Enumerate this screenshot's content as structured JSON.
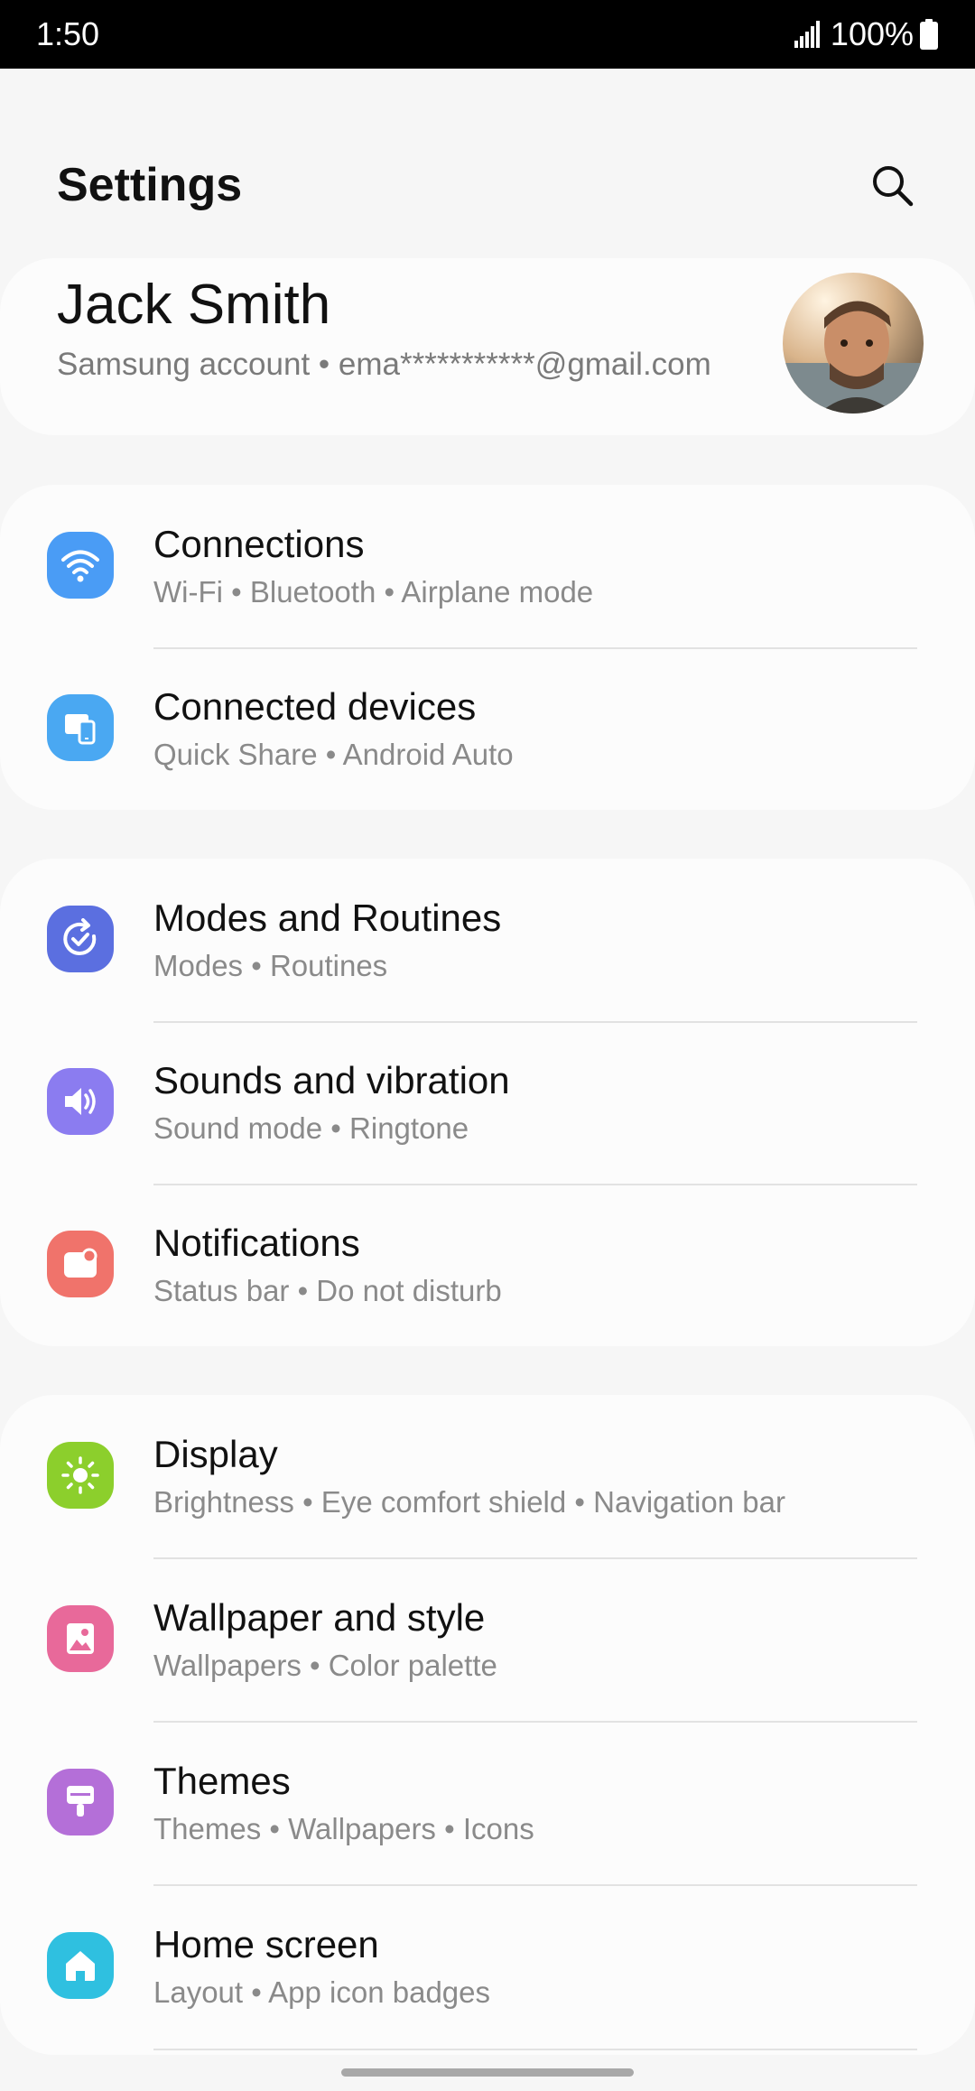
{
  "status": {
    "time": "1:50",
    "battery": "100%"
  },
  "header": {
    "title": "Settings"
  },
  "account": {
    "name": "Jack Smith",
    "subtitle": "Samsung account  •  ema***********@gmail.com"
  },
  "menu": [
    {
      "title": "Connections",
      "subtitle": "Wi-Fi  •  Bluetooth  •  Airplane mode",
      "icon": "wifi-icon",
      "color": "#4a9cf5"
    },
    {
      "title": "Connected devices",
      "subtitle": "Quick Share  •  Android Auto",
      "icon": "connected-devices-icon",
      "color": "#4aa8f2"
    },
    {
      "title": "Modes and Routines",
      "subtitle": "Modes  •  Routines",
      "icon": "routines-icon",
      "color": "#5b6fe0"
    },
    {
      "title": "Sounds and vibration",
      "subtitle": "Sound mode  •  Ringtone",
      "icon": "volume-icon",
      "color": "#8b7cf0"
    },
    {
      "title": "Notifications",
      "subtitle": "Status bar  •  Do not disturb",
      "icon": "notification-icon",
      "color": "#f0736b"
    },
    {
      "title": "Display",
      "subtitle": "Brightness  •  Eye comfort shield  •  Navigation bar",
      "icon": "brightness-icon",
      "color": "#8ccf2c"
    },
    {
      "title": "Wallpaper and style",
      "subtitle": "Wallpapers  •  Color palette",
      "icon": "wallpaper-icon",
      "color": "#e8699a"
    },
    {
      "title": "Themes",
      "subtitle": "Themes  •  Wallpapers  •  Icons",
      "icon": "themes-icon",
      "color": "#b46fd8"
    },
    {
      "title": "Home screen",
      "subtitle": "Layout  •  App icon badges",
      "icon": "home-icon",
      "color": "#2fc0e0"
    }
  ]
}
